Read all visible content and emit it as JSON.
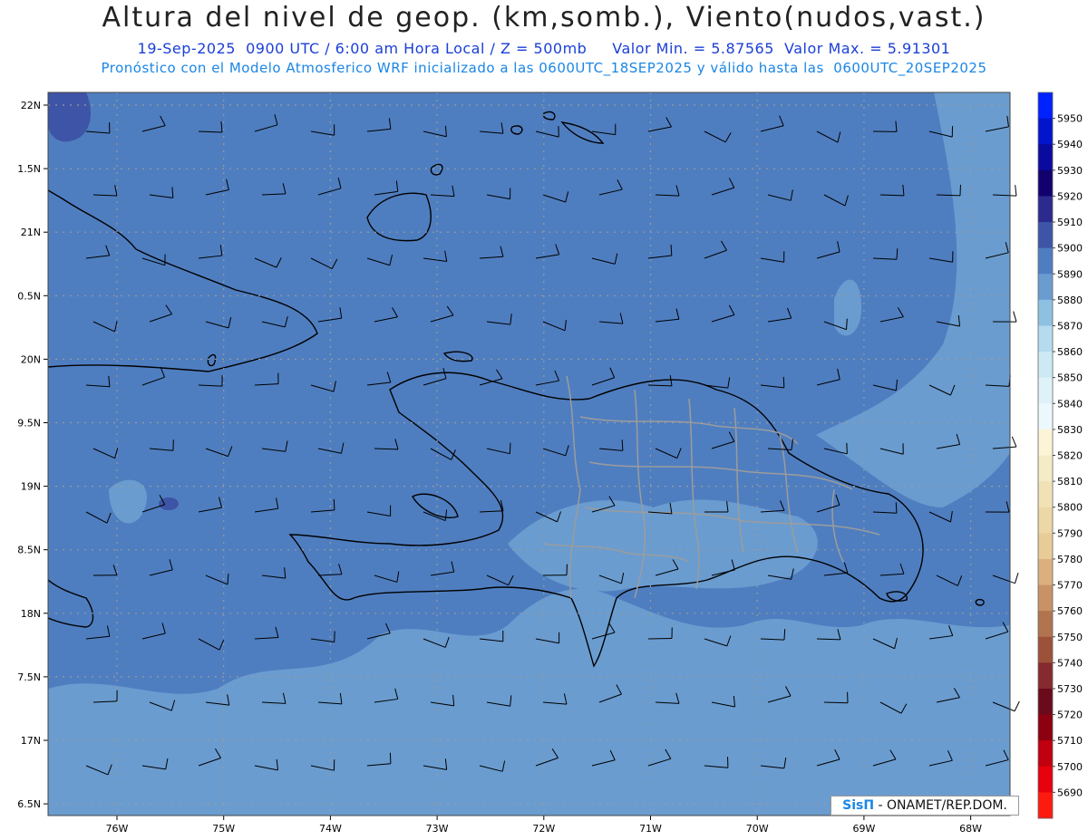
{
  "header": {
    "title": "Altura del nivel de geop. (km,somb.), Viento(nudos,vast.)",
    "subtitle_date": "19-Sep-2025  0900 UTC / 6:00 am Hora Local / Z = 500mb     Valor Min. = 5.87565  Valor Max. = 5.91301",
    "subtitle_model": "Pronóstico con el Modelo Atmosferico WRF inicializado a las 0600UTC_18SEP2025 y válido hasta las  0600UTC_20SEP2025"
  },
  "axes": {
    "lat_labels": [
      "22N",
      "1.5N",
      "21N",
      "0.5N",
      "20N",
      "9.5N",
      "19N",
      "8.5N",
      "18N",
      "7.5N",
      "17N",
      "6.5N"
    ],
    "lon_labels": [
      "76W",
      "75W",
      "74W",
      "73W",
      "72W",
      "71W",
      "70W",
      "69W",
      "68W"
    ]
  },
  "colorbar": {
    "levels": [
      "5950",
      "5940",
      "5930",
      "5920",
      "5910",
      "5900",
      "5890",
      "5880",
      "5870",
      "5860",
      "5850",
      "5840",
      "5830",
      "5820",
      "5810",
      "5800",
      "5790",
      "5780",
      "5770",
      "5760",
      "5750",
      "5740",
      "5730",
      "5720",
      "5710",
      "5700",
      "5690"
    ],
    "colors": [
      "#0022ff",
      "#0015cc",
      "#0a0a9e",
      "#12006e",
      "#2c2a8e",
      "#3e54a6",
      "#4f7ec0",
      "#6a9cd0",
      "#8ec0e2",
      "#b4dcee",
      "#cdeaf4",
      "#dff2f8",
      "#ecf8fb",
      "#fbf4d6",
      "#f5ebc6",
      "#f1e2b6",
      "#ecd7a6",
      "#e8cc98",
      "#dcb07e",
      "#c99266",
      "#b2744e",
      "#9c5238",
      "#852a2e",
      "#6a0a1a",
      "#8c0010",
      "#c0000e",
      "#e8000c",
      "#ff1a10"
    ]
  },
  "credit": {
    "brand": "SisΠ",
    "text": " - ONAMET/REP.DOM."
  }
}
